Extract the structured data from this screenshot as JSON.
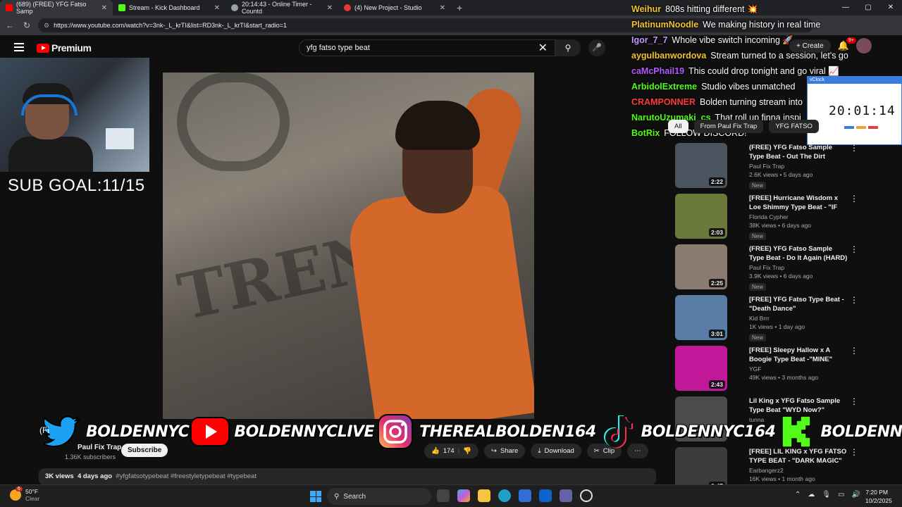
{
  "browser": {
    "tabs": [
      {
        "title": "(689) (FREE) YFG Fatso Samp",
        "icon": "youtube-icon",
        "color": "#ff0000"
      },
      {
        "title": "Stream - Kick Dashboard",
        "icon": "kick-icon",
        "color": "#53fc18"
      },
      {
        "title": "20:14:43 - Online Timer - Countd",
        "icon": "timer-icon",
        "color": "#9aa0a6"
      },
      {
        "title": "(4) New Project - Studio",
        "icon": "studio-icon",
        "color": "#e53935"
      }
    ],
    "url": "https://www.youtube.com/watch?v=3nk-_L_krTI&list=RD3nk-_L_krTI&start_radio=1"
  },
  "youtube": {
    "brand": "Premium",
    "search_value": "yfg fatso type beat",
    "create_label": "Create",
    "notif_count": "9+"
  },
  "chat": [
    {
      "user": "Weihur",
      "msg": "808s hitting different 💥",
      "color": "#f4c430"
    },
    {
      "user": "PlatinumNoodle",
      "msg": "We making history in real time",
      "color": "#f4c430"
    },
    {
      "user": "Igor_7_7",
      "msg": "Whole vibe switch incoming 🚀",
      "color": "#c39bff"
    },
    {
      "user": "aygulbanwordova",
      "msg": "Stream turned to a session, let's go",
      "color": "#f4c430"
    },
    {
      "user": "caMcPhail19",
      "msg": "This could drop tonight and go viral 📈",
      "color": "#b25bff"
    },
    {
      "user": "ArbidolExtreme",
      "msg": "Studio vibes unmatched",
      "color": "#53fc18"
    },
    {
      "user": "CRAMPONNER",
      "msg": "Bolden turning stream into",
      "color": "#ff3b3b"
    },
    {
      "user": "NarutoUzumaki_cs",
      "msg": "That roll up finna inspi",
      "color": "#53fc18"
    },
    {
      "user": "BotRix",
      "msg": "FOLLOW DISCORD!",
      "color": "#53fc18"
    }
  ],
  "overlay": {
    "sub_goal": "SUB GOAL:11/15",
    "socials": [
      {
        "icon": "twitter-icon",
        "handle": "BOLDENNYC"
      },
      {
        "icon": "youtube-icon",
        "handle": "BOLDENNYCLIVE"
      },
      {
        "icon": "instagram-icon",
        "handle": "THEREALBOLDEN164"
      },
      {
        "icon": "tiktok-icon",
        "handle": "BOLDENNYC164"
      },
      {
        "icon": "kick-icon",
        "handle": "BOLDENNYCC"
      }
    ],
    "clock": "20:01:14",
    "clock_title": "vClock"
  },
  "video": {
    "channel": "Paul Fix Trap",
    "subscribers": "1.36K subscribers",
    "subscribe_label": "Subscribe",
    "likes": "174",
    "share_label": "Share",
    "download_label": "Download",
    "clip_label": "Clip",
    "views": "3K views",
    "age": "4 days ago",
    "tags": "#yfgfatsotypebeat #freestyletypebeat #typebeat",
    "title_fragment": "(Fi"
  },
  "sidebar": {
    "chips": [
      "All",
      "From Paul Fix Trap",
      "YFG FATSO"
    ],
    "recommendations": [
      {
        "title": "(FREE) YFG Fatso Sample Type Beat - Out The Dirt (HARD)",
        "channel": "Paul Fix Trap",
        "views": "2.6K views • 5 days ago",
        "duration": "2:22",
        "badge": "New",
        "thumb": "#4a5560"
      },
      {
        "title": "[FREE] Hurricane Wisdom x Loe Shimmy Type Beat - \"IF NOT ...",
        "channel": "Florida Cypher",
        "views": "38K views • 6 days ago",
        "duration": "2:03",
        "badge": "New",
        "thumb": "#6b7a3c"
      },
      {
        "title": "(FREE) YFG Fatso Sample Type Beat - Do It Again (HARD)",
        "channel": "Paul Fix Trap",
        "views": "3.9K views • 6 days ago",
        "duration": "2:25",
        "badge": "New",
        "thumb": "#8a7a70"
      },
      {
        "title": "[FREE] YFG Fatso Type Beat - \"Death Dance\"",
        "channel": "Kid Brrr",
        "views": "1K views • 1 day ago",
        "duration": "3:01",
        "badge": "New",
        "thumb": "#5a7da8"
      },
      {
        "title": "[FREE] Sleepy Hallow x A Boogie Type Beat -\"MINE\"",
        "channel": "YGF",
        "views": "49K views • 3 months ago",
        "duration": "2:43",
        "badge": "",
        "thumb": "#c1189a"
      },
      {
        "title": "Lil King x YFG Fatso Sample Type Beat \"WYD Now?\"",
        "channel": "tunna",
        "views": "",
        "duration": "",
        "badge": "",
        "thumb": "#4b4b4b"
      },
      {
        "title": "[FREE] LIL KING x YFG FATSO TYPE BEAT - \"DARK MAGIC\"",
        "channel": "Earbangerz2",
        "views": "16K views • 1 month ago",
        "duration": "2:47",
        "badge": "",
        "thumb": "#3c3c3c"
      }
    ]
  },
  "taskbar": {
    "temp": "50°F",
    "weather": "Clear",
    "weather_badge": "6",
    "search_placeholder": "Search",
    "time": "7:20 PM",
    "date": "10/2/2025"
  }
}
